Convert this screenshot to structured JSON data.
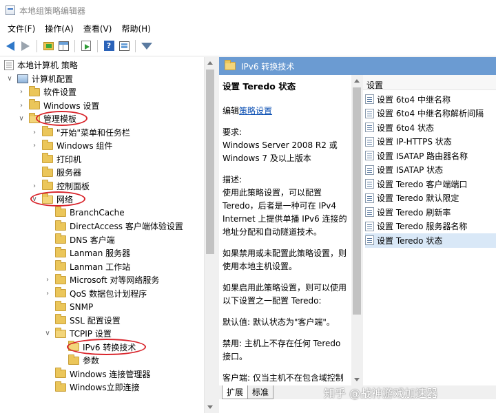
{
  "window": {
    "title": "本地组策略编辑器"
  },
  "menu": [
    "文件(F)",
    "操作(A)",
    "查看(V)",
    "帮助(H)"
  ],
  "toolbar_icons": [
    "back-icon",
    "forward-icon",
    "up-folder-icon",
    "show-hide-tree-icon",
    "export-list-icon",
    "help-icon",
    "view-icon",
    "filter-icon"
  ],
  "tree": {
    "root": "本地计算机 策略",
    "computer_config": "计算机配置",
    "software": "软件设置",
    "windows_settings": "Windows 设置",
    "admin_templates": "管理模板",
    "start_menu": "\"开始\"菜单和任务栏",
    "windows_components": "Windows 组件",
    "printers": "打印机",
    "server": "服务器",
    "control_panel": "控制面板",
    "network": "网络",
    "branchcache": "BranchCache",
    "directaccess": "DirectAccess 客户端体验设置",
    "dns": "DNS 客户端",
    "lanman_server": "Lanman 服务器",
    "lanman_workstation": "Lanman 工作站",
    "ms_p2p": "Microsoft 对等网络服务",
    "qos": "QoS 数据包计划程序",
    "snmp": "SNMP",
    "ssl": "SSL 配置设置",
    "tcpip": "TCPIP 设置",
    "ipv6": "IPv6 转换技术",
    "params": "参数",
    "win_conn_mgr": "Windows 连接管理器",
    "win_instant": "Windows立即连接"
  },
  "right": {
    "header": "IPv6 转换技术",
    "extended": {
      "heading": "设置 Teredo 状态",
      "edit_prefix": "编辑",
      "edit_link": "策略设置",
      "req_label": "要求:",
      "req_text": "Windows Server 2008 R2 或 Windows 7 及以上版本",
      "desc_label": "描述:",
      "desc_text": "使用此策略设置，可以配置 Teredo，后者是一种可在 IPv4 Internet 上提供单播 IPv6 连接的地址分配和自动隧道技术。",
      "p2": "如果禁用或未配置此策略设置，则使用本地主机设置。",
      "p3": "如果启用此策略设置，则可以使用以下设置之一配置 Teredo:",
      "p4": "默认值: 默认状态为\"客户端\"。",
      "p5": "禁用: 主机上不存在任何 Teredo 接口。",
      "p6": "客户端: 仅当主机不在包含域控制器的网络中时，才存在 Teredo 接"
    },
    "settings_header": "设置",
    "settings": [
      "设置 6to4 中继名称",
      "设置 6to4 中继名称解析间隔",
      "设置 6to4 状态",
      "设置 IP-HTTPS 状态",
      "设置 ISATAP 路由器名称",
      "设置 ISATAP 状态",
      "设置 Teredo 客户端端口",
      "设置 Teredo 默认限定",
      "设置 Teredo 刷新率",
      "设置 Teredo 服务器名称",
      "设置 Teredo 状态"
    ],
    "tabs": [
      "扩展",
      "标准"
    ]
  },
  "watermark": "知乎 @战神游戏加速器"
}
